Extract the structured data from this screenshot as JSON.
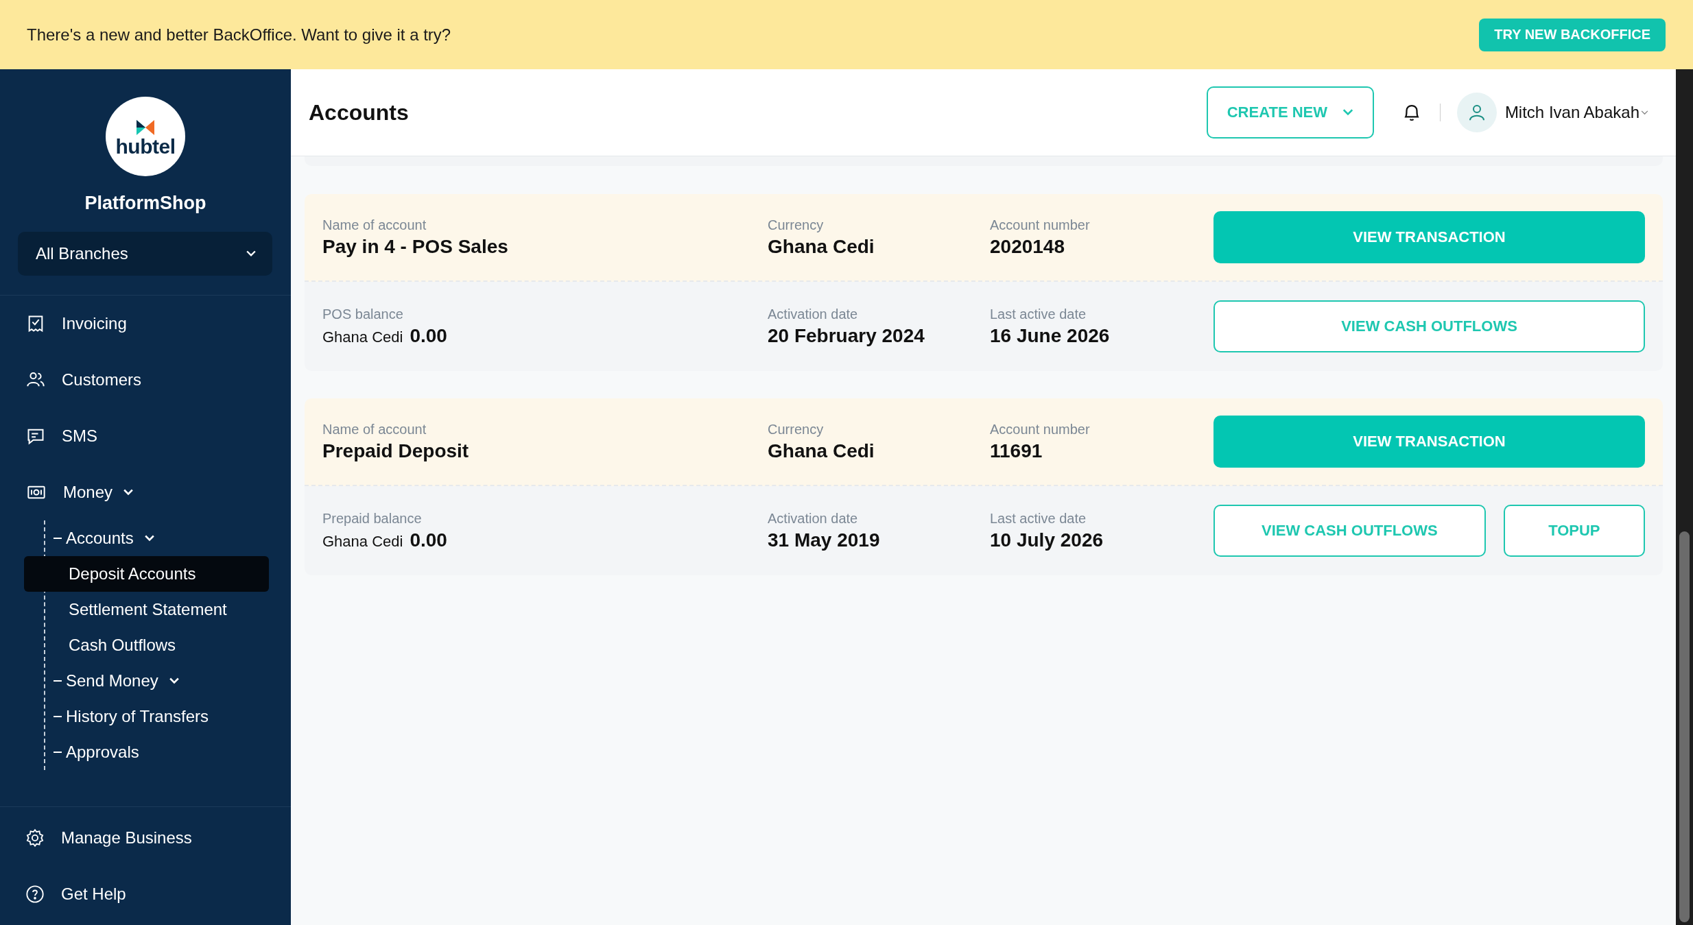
{
  "banner": {
    "message": "There's a new and better BackOffice. Want to give it a try?",
    "button": "TRY NEW BACKOFFICE"
  },
  "sidebar": {
    "logo_text": "hubtel",
    "shop_name": "PlatformShop",
    "branch_select": {
      "value": "All Branches"
    },
    "nav": [
      {
        "label": "Invoicing",
        "selected": false
      },
      {
        "label": "Customers",
        "selected": false
      },
      {
        "label": "SMS",
        "selected": false
      },
      {
        "label": "Money",
        "selected": false,
        "expandable": true,
        "children": [
          {
            "label": "Accounts",
            "selected": false,
            "expandable": true,
            "children": [
              {
                "label": "Deposit Accounts",
                "selected": true
              },
              {
                "label": "Settlement Statement",
                "selected": false
              },
              {
                "label": "Cash Outflows",
                "selected": false
              }
            ]
          },
          {
            "label": "Send Money",
            "selected": false,
            "expandable": true
          },
          {
            "label": "History of Transfers",
            "selected": false
          },
          {
            "label": "Approvals",
            "selected": false
          }
        ]
      }
    ],
    "footer": [
      {
        "label": "Manage Business"
      },
      {
        "label": "Get Help"
      }
    ]
  },
  "header": {
    "title": "Accounts",
    "create_button": "CREATE NEW",
    "user_name": "Mitch Ivan Abakah"
  },
  "accounts": [
    {
      "name_label": "Name of account",
      "name": "Pay in 4 - POS Sales",
      "currency_label": "Currency",
      "currency": "Ghana Cedi",
      "number_label": "Account number",
      "number": "2020148",
      "top_actions": [
        {
          "label": "VIEW TRANSACTION",
          "kind": "primary"
        }
      ],
      "balance_label": "POS balance",
      "balance_currency": "Ghana Cedi",
      "balance": "0.00",
      "activation_label": "Activation date",
      "activation_date": "20 February 2024",
      "last_active_label": "Last active date",
      "last_active_date": "16 June 2026",
      "bottom_actions": [
        {
          "label": "VIEW CASH OUTFLOWS",
          "kind": "outline"
        }
      ]
    },
    {
      "name_label": "Name of account",
      "name": "Prepaid Deposit",
      "currency_label": "Currency",
      "currency": "Ghana Cedi",
      "number_label": "Account number",
      "number": "11691",
      "top_actions": [
        {
          "label": "VIEW TRANSACTION",
          "kind": "primary"
        }
      ],
      "balance_label": "Prepaid balance",
      "balance_currency": "Ghana Cedi",
      "balance": "0.00",
      "activation_label": "Activation date",
      "activation_date": "31 May 2019",
      "last_active_label": "Last active date",
      "last_active_date": "10 July 2026",
      "bottom_actions": [
        {
          "label": "VIEW CASH OUTFLOWS",
          "kind": "outline"
        },
        {
          "label": "TOPUP",
          "kind": "outline"
        }
      ]
    }
  ]
}
